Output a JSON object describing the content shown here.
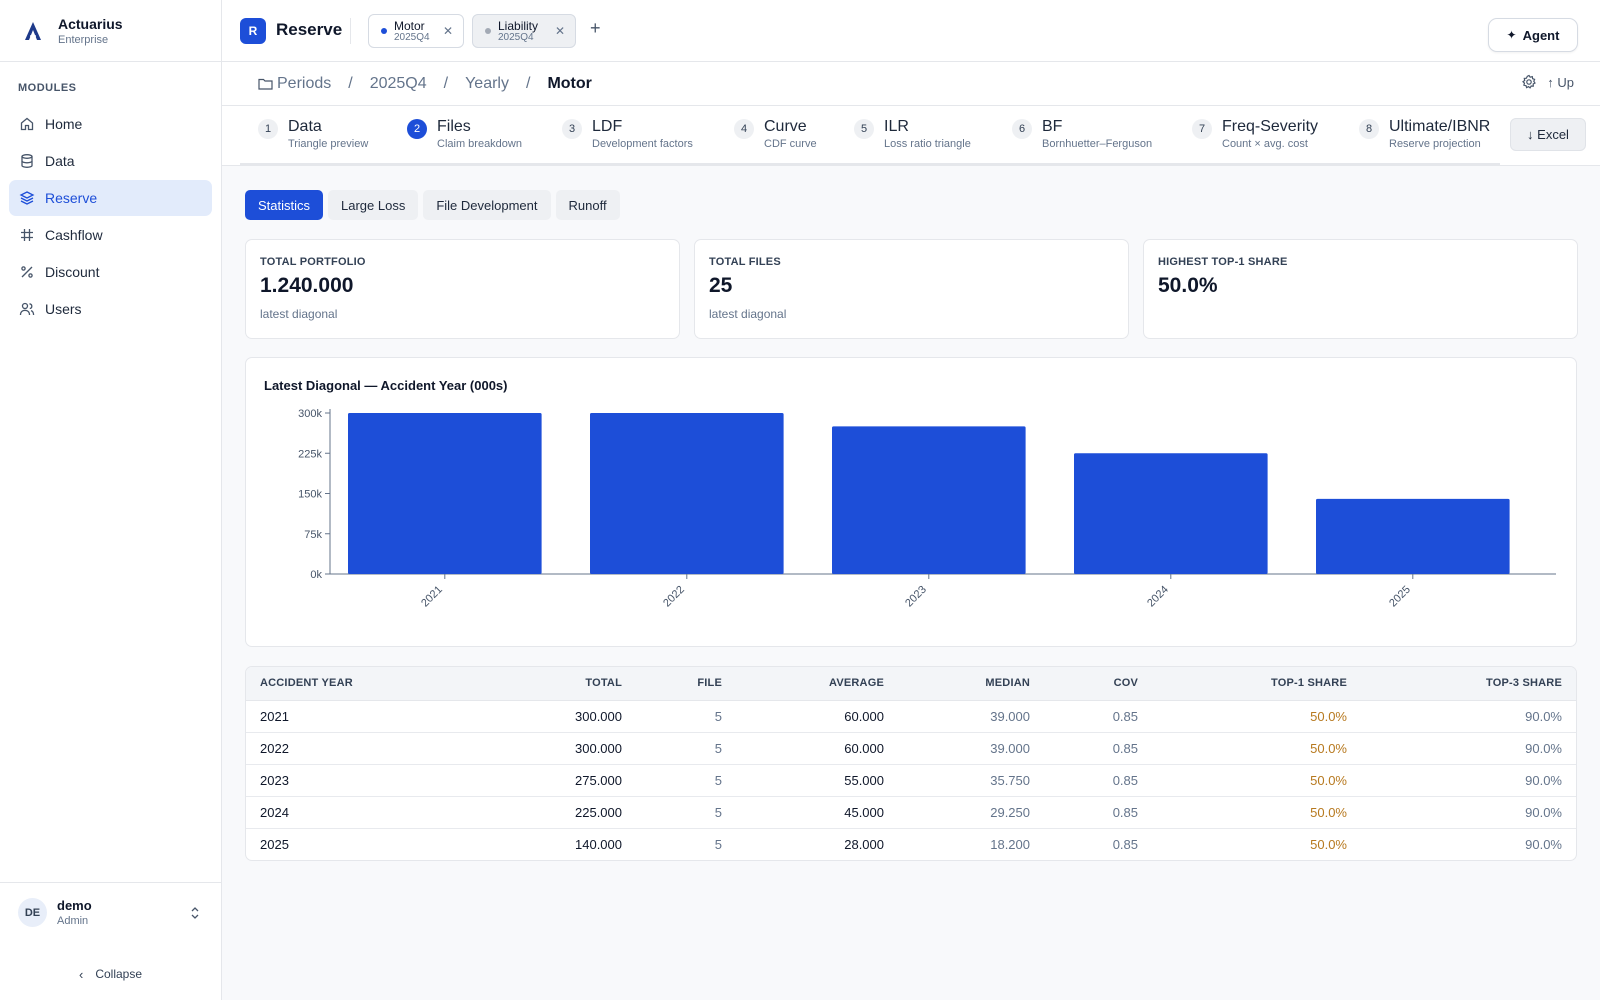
{
  "brand": {
    "name": "Actuarius",
    "edition": "Enterprise"
  },
  "sidebar": {
    "section_label": "MODULES",
    "items": [
      {
        "label": "Home",
        "icon": "home-icon"
      },
      {
        "label": "Data",
        "icon": "database-icon"
      },
      {
        "label": "Reserve",
        "icon": "layers-icon",
        "active": true
      },
      {
        "label": "Cashflow",
        "icon": "hash-icon"
      },
      {
        "label": "Discount",
        "icon": "percent-icon"
      },
      {
        "label": "Users",
        "icon": "users-icon"
      }
    ],
    "user": {
      "initials": "DE",
      "name": "demo",
      "role": "Admin"
    },
    "collapse_label": "Collapse"
  },
  "topbar": {
    "app_badge": "R",
    "app_title": "Reserve",
    "tabs": [
      {
        "name": "Motor",
        "period": "2025Q4",
        "active": true,
        "dot_color": "#1d4ed8"
      },
      {
        "name": "Liability",
        "period": "2025Q4",
        "active": false,
        "dot_color": "#a3aab5"
      }
    ],
    "add_tab": "+",
    "agent_label": "Agent"
  },
  "breadcrumb": {
    "items": [
      "Periods",
      "2025Q4",
      "Yearly",
      "Motor"
    ],
    "separator": "/",
    "up_label": "Up"
  },
  "steps": [
    {
      "num": "1",
      "label": "Data",
      "sub": "Triangle preview"
    },
    {
      "num": "2",
      "label": "Files",
      "sub": "Claim breakdown",
      "active": true
    },
    {
      "num": "3",
      "label": "LDF",
      "sub": "Development factors"
    },
    {
      "num": "4",
      "label": "Curve",
      "sub": "CDF curve"
    },
    {
      "num": "5",
      "label": "ILR",
      "sub": "Loss ratio triangle"
    },
    {
      "num": "6",
      "label": "BF",
      "sub": "Bornhuetter–Ferguson"
    },
    {
      "num": "7",
      "label": "Freq-Severity",
      "sub": "Count × avg. cost"
    },
    {
      "num": "8",
      "label": "Ultimate/IBNR",
      "sub": "Reserve projection"
    }
  ],
  "excel_label": "Excel",
  "subtabs": [
    "Statistics",
    "Large Loss",
    "File Development",
    "Runoff"
  ],
  "kpis": [
    {
      "label": "TOTAL PORTFOLIO",
      "value": "1.240.000",
      "sub": "latest diagonal"
    },
    {
      "label": "TOTAL FILES",
      "value": "25",
      "sub": "latest diagonal"
    },
    {
      "label": "HIGHEST TOP-1 SHARE",
      "value": "50.0%",
      "sub": ""
    }
  ],
  "chart_data": {
    "type": "bar",
    "title": "Latest Diagonal — Accident Year (000s)",
    "categories": [
      "2021",
      "2022",
      "2023",
      "2024",
      "2025"
    ],
    "values": [
      300,
      300,
      275,
      225,
      140
    ],
    "yticks": [
      "0k",
      "75k",
      "150k",
      "225k",
      "300k"
    ],
    "ylim": [
      0,
      300
    ],
    "bar_color": "#1d4ed8",
    "grid": false
  },
  "table": {
    "columns": [
      "ACCIDENT YEAR",
      "TOTAL",
      "FILE",
      "AVERAGE",
      "MEDIAN",
      "COV",
      "TOP-1 SHARE",
      "TOP-3 SHARE"
    ],
    "rows": [
      [
        "2021",
        "300.000",
        "5",
        "60.000",
        "39.000",
        "0.85",
        "50.0%",
        "90.0%"
      ],
      [
        "2022",
        "300.000",
        "5",
        "60.000",
        "39.000",
        "0.85",
        "50.0%",
        "90.0%"
      ],
      [
        "2023",
        "275.000",
        "5",
        "55.000",
        "35.750",
        "0.85",
        "50.0%",
        "90.0%"
      ],
      [
        "2024",
        "225.000",
        "5",
        "45.000",
        "29.250",
        "0.85",
        "50.0%",
        "90.0%"
      ],
      [
        "2025",
        "140.000",
        "5",
        "28.000",
        "18.200",
        "0.85",
        "50.0%",
        "90.0%"
      ]
    ]
  }
}
